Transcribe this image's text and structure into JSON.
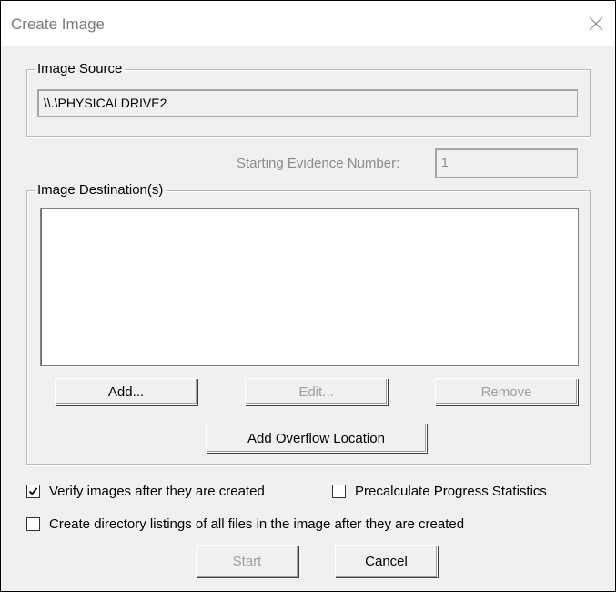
{
  "window": {
    "title": "Create Image"
  },
  "image_source": {
    "group_label": "Image Source",
    "value": "\\\\.\\PHYSICALDRIVE2"
  },
  "evidence": {
    "label": "Starting Evidence Number:",
    "value": "1"
  },
  "destinations": {
    "group_label": "Image Destination(s)",
    "items": [],
    "add_label": "Add...",
    "edit_label": "Edit...",
    "remove_label": "Remove",
    "overflow_label": "Add Overflow Location"
  },
  "options": {
    "verify_label": "Verify images after they are created",
    "verify_checked": true,
    "precalc_label": "Precalculate Progress Statistics",
    "precalc_checked": false,
    "dirlist_label": "Create directory listings of all files in the image after they are created",
    "dirlist_checked": false
  },
  "actions": {
    "start_label": "Start",
    "cancel_label": "Cancel"
  }
}
